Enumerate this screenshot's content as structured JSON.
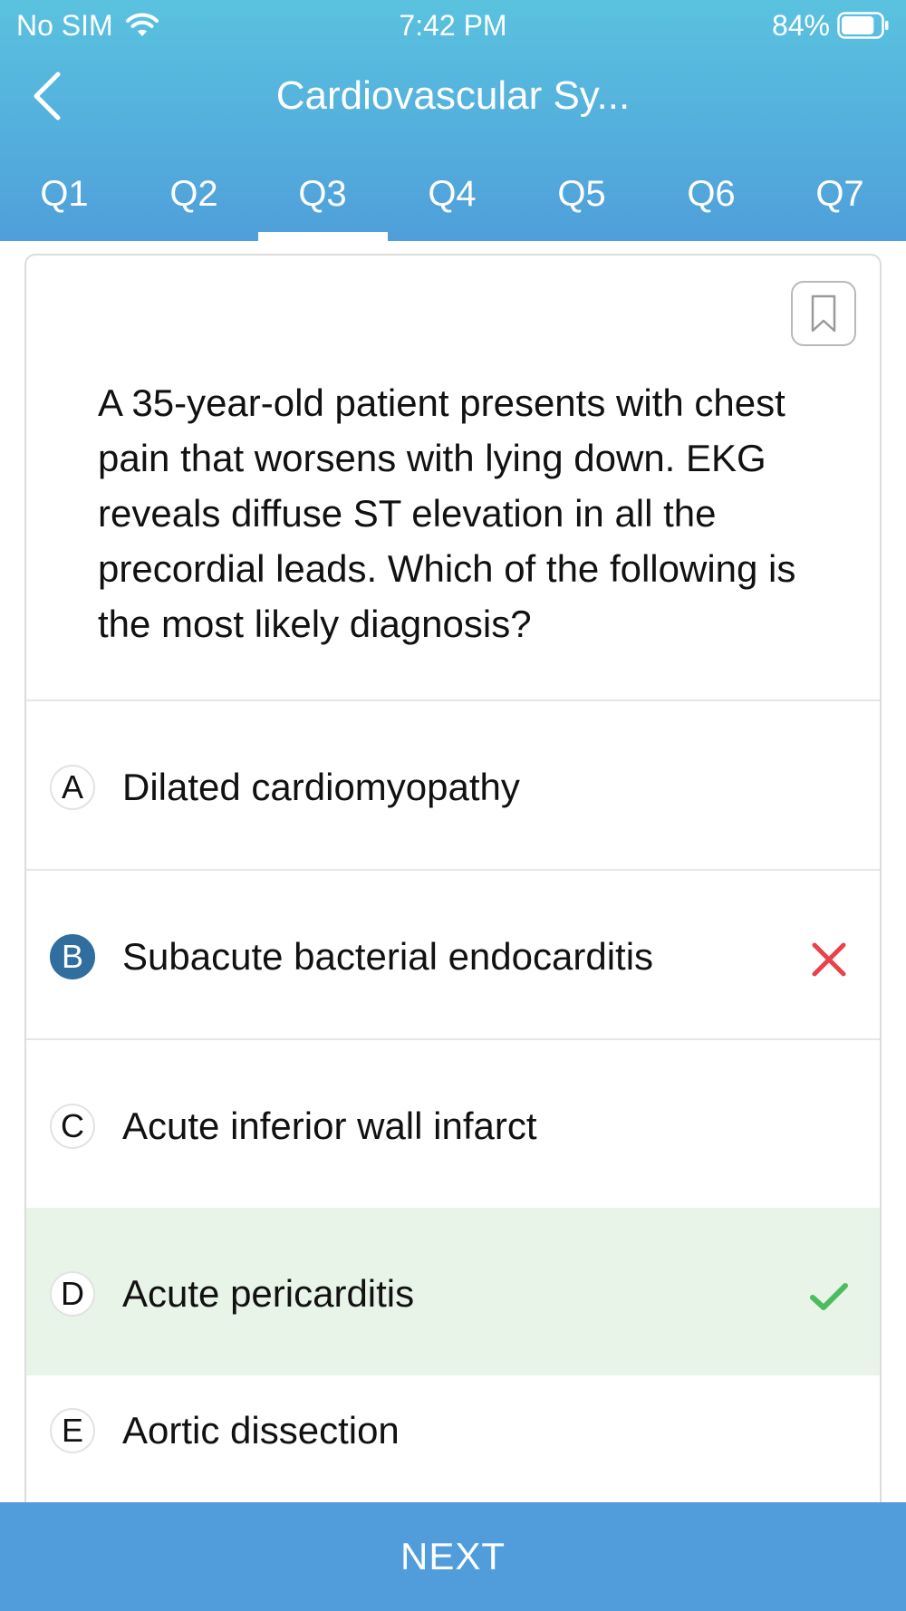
{
  "status_bar": {
    "carrier": "No SIM",
    "time": "7:42 PM",
    "battery_percent": "84%",
    "battery_level": 0.84,
    "icons": [
      "wifi-icon",
      "battery-icon"
    ]
  },
  "nav": {
    "title": "Cardiovascular Sy...",
    "back_icon": "chevron-left-icon"
  },
  "tabs": {
    "items": [
      {
        "label": "Q1"
      },
      {
        "label": "Q2"
      },
      {
        "label": "Q3"
      },
      {
        "label": "Q4"
      },
      {
        "label": "Q5"
      },
      {
        "label": "Q6"
      },
      {
        "label": "Q7"
      }
    ],
    "active": "Q3"
  },
  "question": {
    "bookmark_icon": "bookmark-icon",
    "text": "A 35-year-old patient presents with chest pain that worsens with lying down. EKG reveals diffuse ST elevation in all the precordial leads. Which of the following is the most likely diagnosis?"
  },
  "options": [
    {
      "letter": "A",
      "text": "Dilated cardiomyopathy",
      "state": "none"
    },
    {
      "letter": "B",
      "text": "Subacute bacterial endocarditis",
      "state": "selected-wrong"
    },
    {
      "letter": "C",
      "text": "Acute inferior wall infarct",
      "state": "none"
    },
    {
      "letter": "D",
      "text": "Acute pericarditis",
      "state": "correct"
    },
    {
      "letter": "E",
      "text": "Aortic dissection",
      "state": "none"
    }
  ],
  "colors": {
    "header_top": "#5ac2df",
    "header_bottom": "#4f9fda",
    "selected_badge": "#2f6e9e",
    "wrong_mark": "#e8424a",
    "correct_mark": "#4cbc5e",
    "correct_bg": "#e9f4e8",
    "next_button": "#519ddb"
  },
  "footer": {
    "next_label": "NEXT"
  }
}
